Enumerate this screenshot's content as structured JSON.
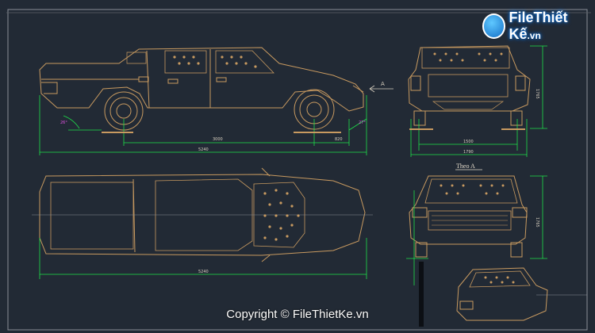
{
  "watermark": {
    "brand": "File",
    "brand_tail": "Thiết Kế",
    "tld": ".vn"
  },
  "copyright": "Copyright © FileThietKe.vn",
  "labels": {
    "side_wheelbase": "3000",
    "side_overhang": "820",
    "side_length": "5240",
    "side_angle_left": "26°",
    "side_angle_right": "27°",
    "rear_track": "1500",
    "rear_width": "1790",
    "rear_height": "1765",
    "top_length": "5240",
    "section_mark": "A",
    "front_view_title": "Theo A",
    "front_height": "1765"
  },
  "colors": {
    "background": "#222a35",
    "car_line": "#c89a60",
    "dimension": "#1ee04a",
    "annotation": "#e050e0",
    "border": "#8a8f96"
  }
}
